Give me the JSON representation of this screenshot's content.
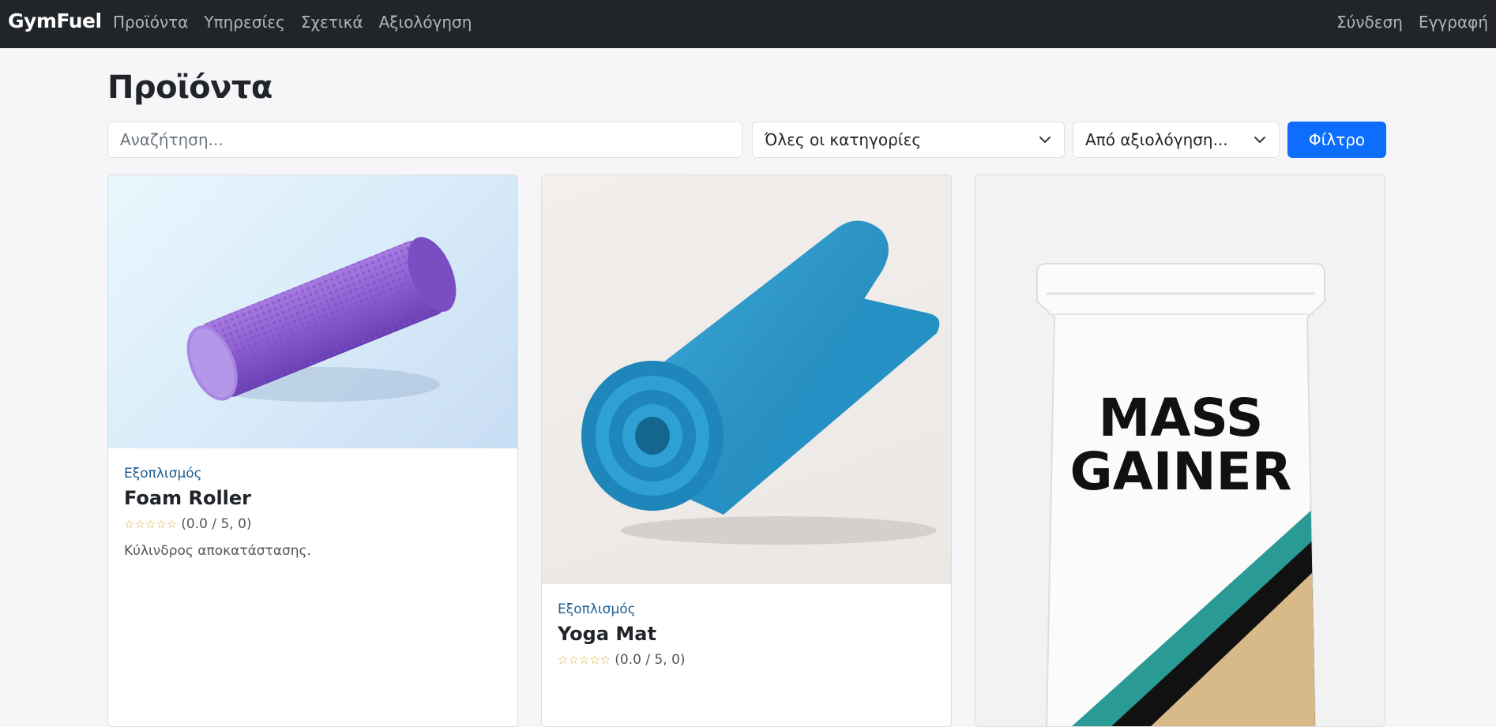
{
  "navbar": {
    "brand": "GymFuel",
    "links": [
      "Προϊόντα",
      "Υπηρεσίες",
      "Σχετικά",
      "Αξιολόγηση"
    ],
    "right_links": [
      "Σύνδεση",
      "Εγγραφή"
    ]
  },
  "page": {
    "title": "Προϊόντα"
  },
  "filters": {
    "search_placeholder": "Αναζήτηση...",
    "category_selected": "Όλες οι κατηγορίες",
    "rating_selected": "Από αξιολόγηση...",
    "filter_button": "Φίλτρο"
  },
  "products": [
    {
      "category": "Εξοπλισμός",
      "title": "Foam Roller",
      "stars": "☆☆☆☆☆",
      "rating_text": "(0.0 / 5, 0)",
      "description": "Κύλινδρος αποκατάστασης.",
      "image_icon": "foam-roller-image",
      "color": "#9a6ad6"
    },
    {
      "category": "Εξοπλισμός",
      "title": "Yoga Mat",
      "stars": "☆☆☆☆☆",
      "rating_text": "(0.0 / 5, 0)",
      "image_icon": "yoga-mat-image",
      "color": "#2a93c8"
    },
    {
      "image_text_line1": "MASS",
      "image_text_line2": "GAINER",
      "image_icon": "mass-gainer-image"
    }
  ],
  "colors": {
    "navbar_bg": "#212529",
    "primary": "#0d6efd",
    "category_link": "#1f5e93",
    "star": "#e0b034"
  }
}
